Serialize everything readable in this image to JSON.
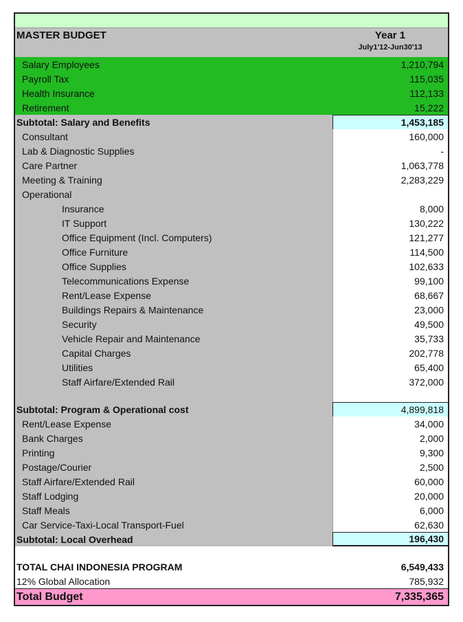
{
  "header": {
    "title": "MASTER BUDGET",
    "year": "Year 1",
    "period": "July1'12-Jun30'13"
  },
  "salary_items": [
    {
      "label": "Salary Employees",
      "value": "1,210,794"
    },
    {
      "label": "Payroll Tax",
      "value": "115,035"
    },
    {
      "label": "Health Insurance",
      "value": "112,133"
    },
    {
      "label": "Retirement",
      "value": "15,222"
    }
  ],
  "subtotal_salary": {
    "label": "Subtotal: Salary and Benefits",
    "value": "1,453,185"
  },
  "program_items": [
    {
      "label": "Consultant",
      "value": "160,000"
    },
    {
      "label": "Lab & Diagnostic Supplies",
      "value": "-"
    },
    {
      "label": "Care Partner",
      "value": "1,063,778"
    },
    {
      "label": "Meeting & Training",
      "value": "2,283,229"
    },
    {
      "label": "Operational",
      "value": ""
    }
  ],
  "operational_items": [
    {
      "label": "Insurance",
      "value": "8,000"
    },
    {
      "label": "IT Support",
      "value": "130,222"
    },
    {
      "label": "Office Equipment (Incl. Computers)",
      "value": "121,277"
    },
    {
      "label": "Office Furniture",
      "value": "114,500"
    },
    {
      "label": "Office Supplies",
      "value": "102,633"
    },
    {
      "label": "Telecommunications Expense",
      "value": "99,100"
    },
    {
      "label": "Rent/Lease Expense",
      "value": "68,667"
    },
    {
      "label": "Buildings Repairs & Maintenance",
      "value": "23,000"
    },
    {
      "label": "Security",
      "value": "49,500"
    },
    {
      "label": "Vehicle Repair and Maintenance",
      "value": "35,733"
    },
    {
      "label": "Capital Charges",
      "value": "202,778"
    },
    {
      "label": "Utilities",
      "value": "65,400"
    },
    {
      "label": "Staff Airfare/Extended Rail",
      "value": "372,000"
    }
  ],
  "subtotal_program": {
    "label": "Subtotal: Program & Operational cost",
    "value": "4,899,818"
  },
  "overhead_items": [
    {
      "label": "Rent/Lease Expense",
      "value": "34,000"
    },
    {
      "label": "Bank Charges",
      "value": "2,000"
    },
    {
      "label": "Printing",
      "value": "9,300"
    },
    {
      "label": "Postage/Courier",
      "value": "2,500"
    },
    {
      "label": "Staff Airfare/Extended Rail",
      "value": "60,000"
    },
    {
      "label": "Staff Lodging",
      "value": "20,000"
    },
    {
      "label": "Staff Meals",
      "value": "6,000"
    },
    {
      "label": "Car Service-Taxi-Local Transport-Fuel",
      "value": "62,630"
    }
  ],
  "subtotal_overhead": {
    "label": "Subtotal: Local Overhead",
    "value": "196,430"
  },
  "total_program": {
    "label": "TOTAL CHAI INDONESIA PROGRAM",
    "value": "6,549,433"
  },
  "global_allocation": {
    "label": "12% Global Allocation",
    "value": "785,932"
  },
  "total_budget": {
    "label": "Total Budget",
    "value": "7,335,365"
  },
  "colors": {
    "header_band": "#ccffcc",
    "label_gray": "#c0c0c0",
    "salary_green": "#22bb22",
    "subtotal_cyan": "#ccffff",
    "total_pink": "#ff99cc"
  }
}
